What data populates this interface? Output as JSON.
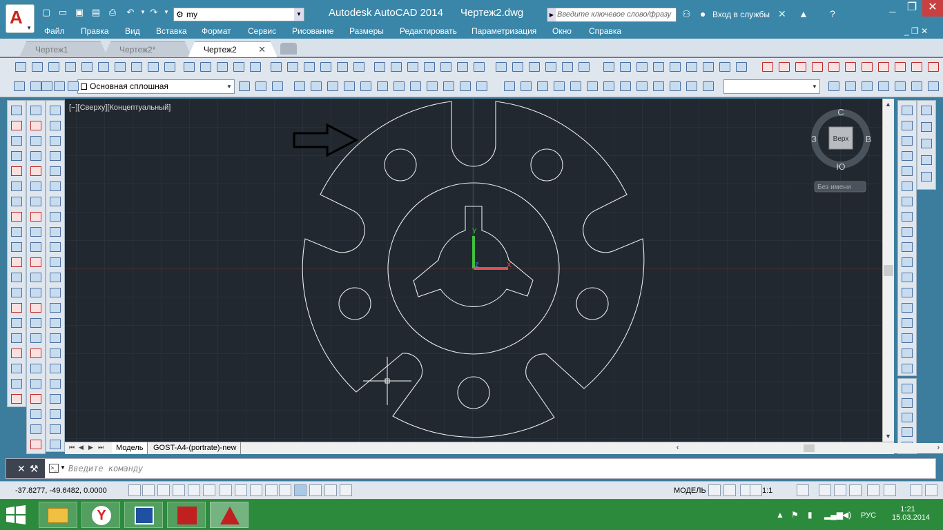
{
  "app": {
    "logo": "A",
    "title": "Autodesk AutoCAD 2014",
    "drawing": "Чертеж2.dwg"
  },
  "quick_access": {
    "workspace": "my"
  },
  "search": {
    "placeholder": "Введите ключевое слово/фразу"
  },
  "signin": {
    "label": "Вход в службы"
  },
  "menus": [
    "Файл",
    "Правка",
    "Вид",
    "Вставка",
    "Формат",
    "Сервис",
    "Рисование",
    "Размеры",
    "Редактировать",
    "Параметризация",
    "Окно",
    "Справка"
  ],
  "tabs": [
    {
      "label": "Чертеж1",
      "active": false
    },
    {
      "label": "Чертеж2*",
      "active": false
    },
    {
      "label": "Чертеж2",
      "active": true
    }
  ],
  "properties": {
    "linetype": "Основная сплошная"
  },
  "viewport": {
    "label": "[−][Сверху][Концептуальный]"
  },
  "viewcube": {
    "top_face": "Верх",
    "north": "С",
    "south": "Ю",
    "east": "В",
    "west": "З",
    "ucs": "Без имени"
  },
  "ucs_icon": {
    "x": "X",
    "y": "Y",
    "z": "Z"
  },
  "layout_tabs": [
    "Модель",
    "GOST-A4-(portrate)-new"
  ],
  "command": {
    "placeholder": "Введите команду"
  },
  "status": {
    "coords": "-37.8277, -49.6482, 0.0000",
    "model": "МОДЕЛЬ",
    "scale": "1:1"
  },
  "taskbar": {
    "lang": "РУС",
    "time": "1:21",
    "date": "15.03.2014"
  },
  "colors": {
    "accent": "#3a86a8",
    "canvas": "#212830",
    "taskbar": "#2c8a3c",
    "ucs_x": "#e05050",
    "ucs_y": "#40c040"
  }
}
